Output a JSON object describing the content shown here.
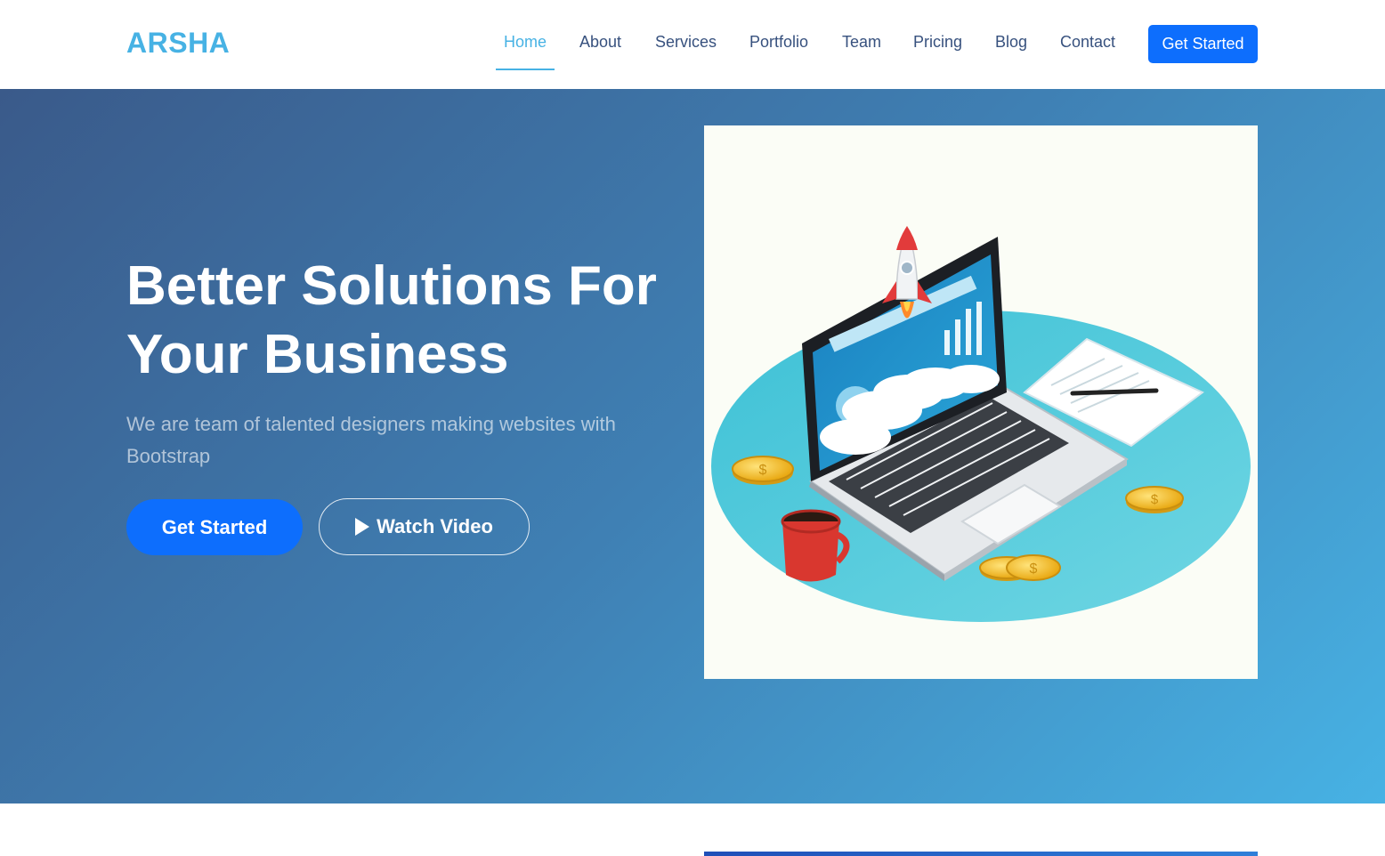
{
  "brand": {
    "logo": "ARSHA"
  },
  "nav": {
    "items": [
      "Home",
      "About",
      "Services",
      "Portfolio",
      "Team",
      "Pricing",
      "Blog",
      "Contact"
    ],
    "active": "Home",
    "cta_label": "Get Started"
  },
  "hero": {
    "title_line1": "Better Solutions For",
    "title_line2": "Your Business",
    "subtitle": "We are team of talented designers making websites with Bootstrap",
    "primary_button": "Get Started",
    "video_button": "Watch Video"
  },
  "colors": {
    "brand": "#47b2e4",
    "nav_text": "#37517e",
    "button_blue": "#0d6efd",
    "hero_gradient_start": "#3a5a8a",
    "hero_gradient_end": "#47b2e4"
  },
  "icons": {
    "play": "play-icon",
    "illustration": "rocket-laptop-illustration"
  }
}
